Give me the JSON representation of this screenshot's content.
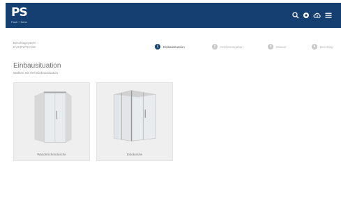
{
  "header": {
    "logo_text": "PS",
    "logo_sub": "Pauli + Sohn",
    "icons": [
      "search-icon",
      "globe-icon",
      "cloud-upload-icon",
      "menu-icon"
    ],
    "background_color": "#143f70"
  },
  "context": {
    "label": "Beschlagsystem",
    "value": "EVERYPEACE"
  },
  "steps": [
    {
      "number": "1",
      "label": "Einbausituation",
      "active": true
    },
    {
      "number": "2",
      "label": "Größenangaben",
      "active": false
    },
    {
      "number": "3",
      "label": "Glasart",
      "active": false
    },
    {
      "number": "4",
      "label": "Beschlag",
      "active": false
    }
  ],
  "main": {
    "title": "Einbausituation",
    "subtitle": "Wählen Sie Ihre Einbausituation"
  },
  "cards": [
    {
      "caption": "Wandnischendusche"
    },
    {
      "caption": "Eckdusche"
    }
  ]
}
